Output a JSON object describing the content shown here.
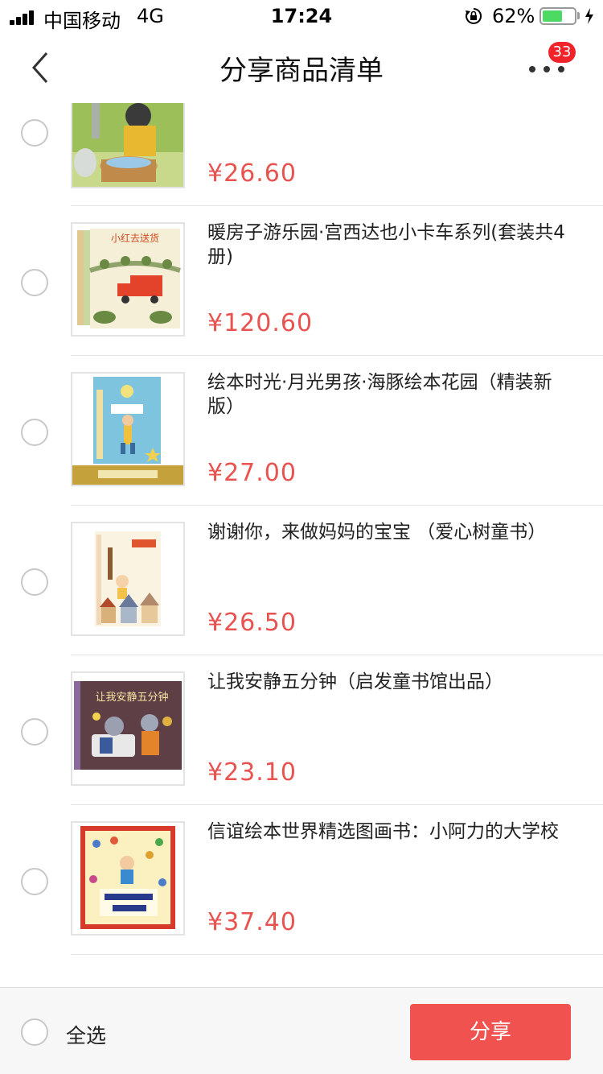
{
  "status_bar": {
    "carrier": "中国移动",
    "network": "4G",
    "time": "17:24",
    "battery_percent": "62%",
    "battery_level": 0.62
  },
  "nav": {
    "title": "分享商品清单",
    "back_icon": "chevron-left-icon",
    "more_icon": "more-dots-icon",
    "badge_count": "33"
  },
  "products": [
    {
      "name": "",
      "price": "¥26.60"
    },
    {
      "name": "暖房子游乐园·宫西达也小卡车系列(套装共4册)",
      "price": "¥120.60"
    },
    {
      "name": "绘本时光·月光男孩·海豚绘本花园（精装新版）",
      "price": "¥27.00"
    },
    {
      "name": "谢谢你，来做妈妈的宝宝 （爱心树童书）",
      "price": "¥26.50"
    },
    {
      "name": "让我安静五分钟（启发童书馆出品）",
      "price": "¥23.10"
    },
    {
      "name": "信谊绘本世界精选图画书：小阿力的大学校",
      "price": "¥37.40"
    }
  ],
  "bottom": {
    "select_all_label": "全选",
    "share_label": "分享"
  },
  "colors": {
    "price": "#e8524f",
    "share_button": "#f05250",
    "badge": "#f0232a"
  }
}
